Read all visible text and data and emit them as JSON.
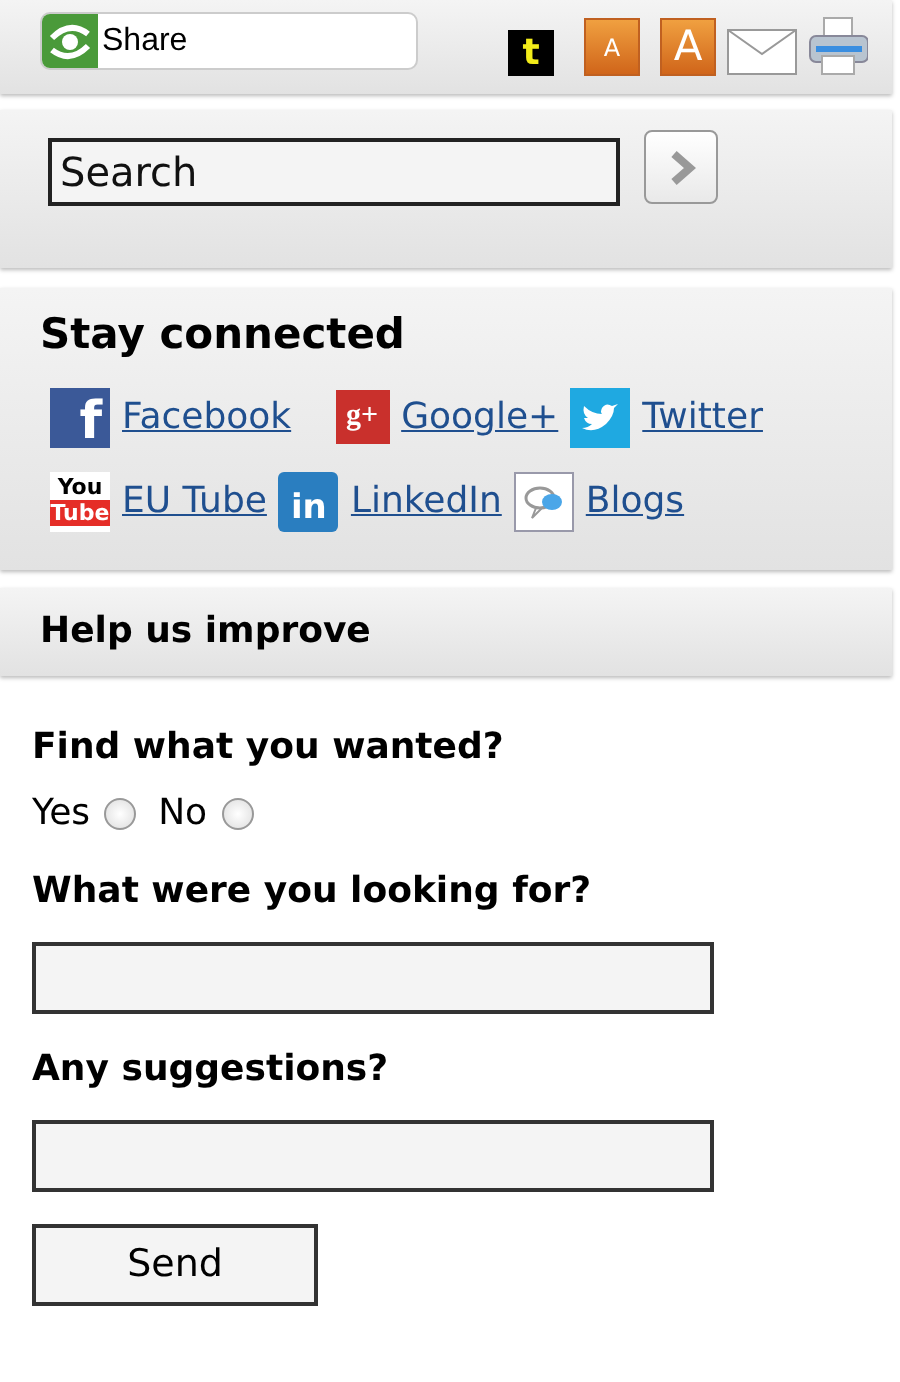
{
  "toolbar": {
    "share_label": "Share",
    "tools": [
      {
        "kind": "tumblr",
        "glyph": "t"
      },
      {
        "kind": "font-small",
        "glyph": "A"
      },
      {
        "kind": "font-large",
        "glyph": "A"
      },
      {
        "kind": "mail"
      },
      {
        "kind": "print"
      }
    ]
  },
  "search": {
    "value": "Search"
  },
  "stay_connected": {
    "title": "Stay connected",
    "rows": [
      [
        {
          "kind": "facebook",
          "glyph": "f",
          "label": "Facebook"
        },
        {
          "kind": "googleplus",
          "glyph": "g+",
          "label": "Google+"
        },
        {
          "kind": "twitter",
          "label": "Twitter"
        }
      ],
      [
        {
          "kind": "youtube",
          "glyph": "You Tube",
          "label": "EU Tube"
        },
        {
          "kind": "linkedin",
          "glyph": "in",
          "label": "LinkedIn"
        },
        {
          "kind": "blogs",
          "label": "Blogs"
        }
      ]
    ]
  },
  "feedback": {
    "title": "Help us improve",
    "question": "Find what you wanted?",
    "options": [
      {
        "label": "Yes",
        "checked": false
      },
      {
        "label": "No",
        "checked": false
      }
    ],
    "fields": [
      {
        "label": "What were you looking for?"
      },
      {
        "label": "Any suggestions?"
      }
    ],
    "submit": "Send"
  }
}
